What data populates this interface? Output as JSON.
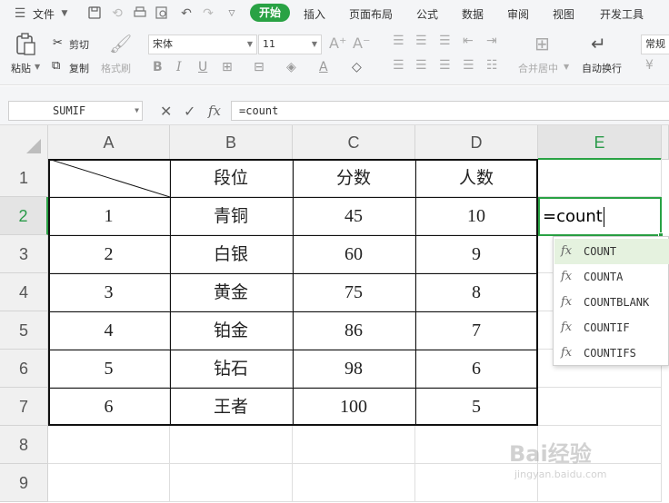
{
  "menubar": {
    "file_label": "文件",
    "tabs": [
      {
        "label": "开始",
        "active": true
      },
      {
        "label": "插入"
      },
      {
        "label": "页面布局"
      },
      {
        "label": "公式"
      },
      {
        "label": "数据"
      },
      {
        "label": "审阅"
      },
      {
        "label": "视图"
      },
      {
        "label": "开发工具"
      }
    ]
  },
  "ribbon": {
    "paste": "粘贴",
    "cut": "剪切",
    "copy": "复制",
    "format_painter": "格式刷",
    "font_name": "宋体",
    "font_size": "11",
    "merge_center": "合并居中",
    "wrap_text": "自动换行",
    "number_format": "常规"
  },
  "formula_bar": {
    "name_box": "SUMIF",
    "fx": "fx",
    "value": "=count"
  },
  "grid": {
    "columns": [
      "A",
      "B",
      "C",
      "D",
      "E"
    ],
    "rows": [
      "1",
      "2",
      "3",
      "4",
      "5",
      "6",
      "7",
      "8",
      "9"
    ],
    "header": [
      "段位",
      "分数",
      "人数"
    ],
    "data": [
      [
        "1",
        "青铜",
        "45",
        "10"
      ],
      [
        "2",
        "白银",
        "60",
        "9"
      ],
      [
        "3",
        "黄金",
        "75",
        "8"
      ],
      [
        "4",
        "铂金",
        "86",
        "7"
      ],
      [
        "5",
        "钻石",
        "98",
        "6"
      ],
      [
        "6",
        "王者",
        "100",
        "5"
      ]
    ],
    "active_cell_text": "=count"
  },
  "autocomplete": {
    "icon": "fx",
    "items": [
      "COUNT",
      "COUNTA",
      "COUNTBLANK",
      "COUNTIF",
      "COUNTIFS"
    ]
  },
  "watermark": {
    "text": "Bai经验",
    "sub": "jingyan.baidu.com"
  },
  "colors": {
    "accent": "#29a244",
    "selection_fill": "#e5f2df"
  }
}
